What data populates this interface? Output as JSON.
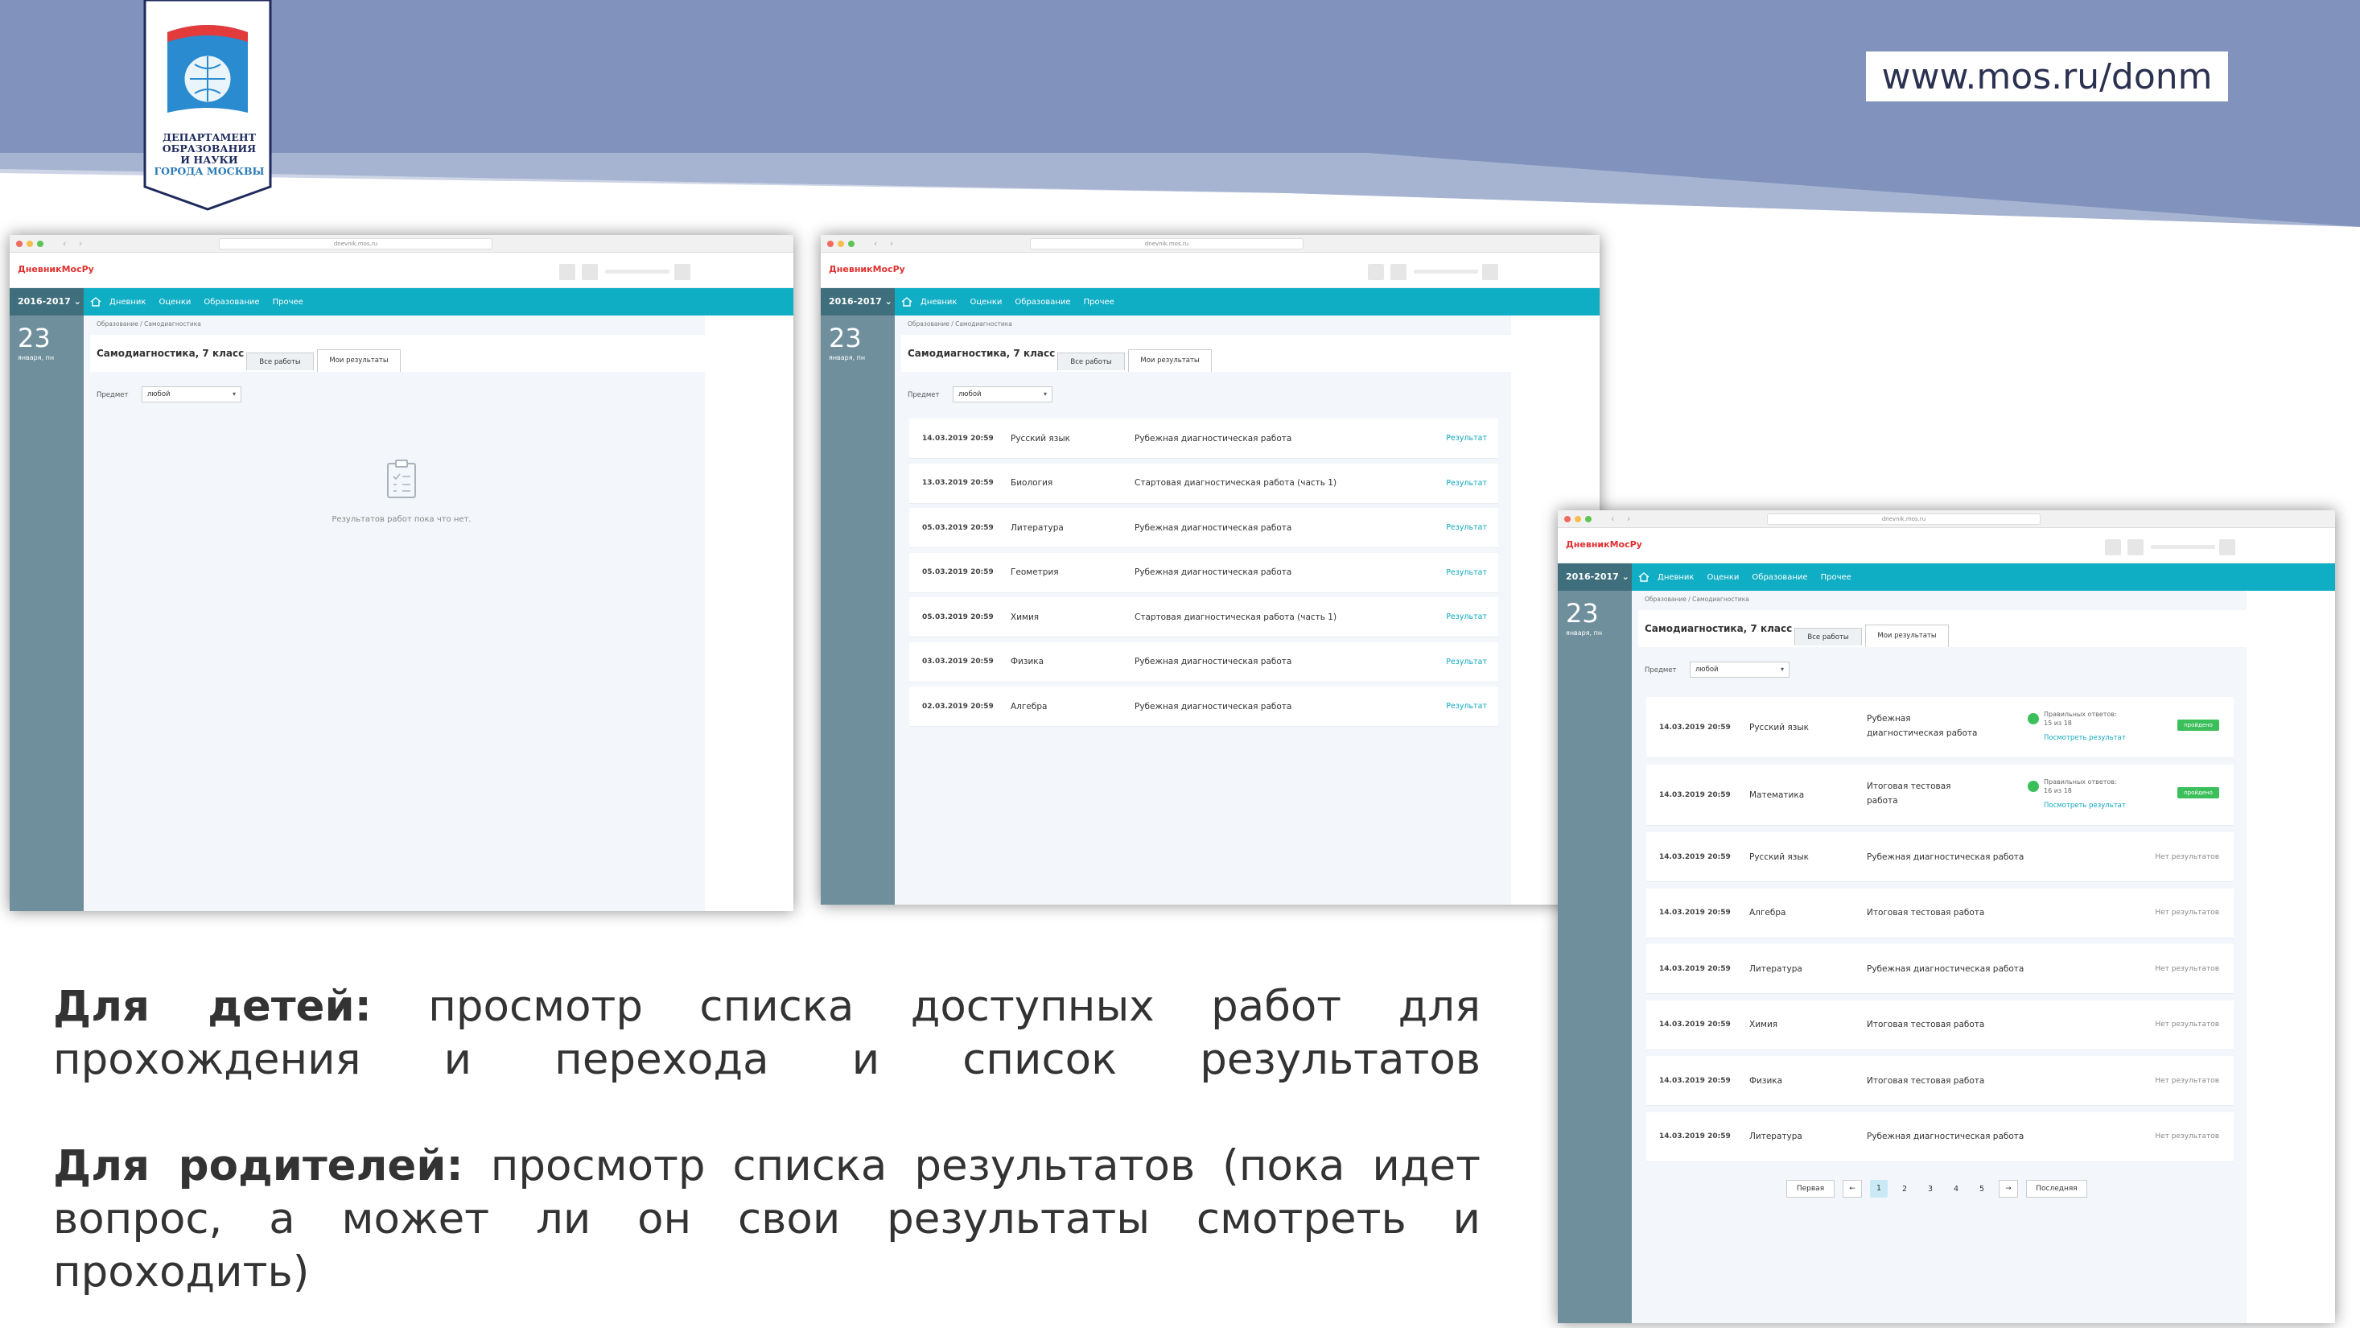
{
  "slide": {
    "website": "www.mos.ru/donm",
    "logo": {
      "line1": "ДЕПАРТАМЕНТ",
      "line2": "ОБРАЗОВАНИЯ",
      "line3": "И НАУКИ",
      "line4": "ГОРОДА МОСКВЫ"
    },
    "caption": {
      "children_label": "Для детей:",
      "children_text": "просмотр списка доступных работ для прохождения и перехода и список результатов",
      "parents_label": "Для родителей:",
      "parents_text": "просмотр списка результатов (пока идет вопрос, а может ли он свои результаты смотреть и проходить)"
    },
    "colors": {
      "band": "#8193bd",
      "teal": "#10aec4",
      "sidebar": "#6f8f9c",
      "green": "#3cbf5a",
      "brand_red": "#e03030"
    }
  },
  "app": {
    "address": "dnevnik.mos.ru",
    "brand": "ДневникМосРу",
    "year": "2016-2017",
    "menu": [
      "Дневник",
      "Оценки",
      "Образование",
      "Прочее"
    ],
    "day_number": "23",
    "day_label": "января, пн",
    "breadcrumb": "Образование  /  Самодиагностика",
    "page_title": "Самодиагностика, 7 класс",
    "tab_all": "Все работы",
    "tab_mine": "Мои результаты",
    "filter_label": "Предмет",
    "filter_value": "любой",
    "empty_message": "Результатов работ пока что нет.",
    "result_link": "Результат",
    "correct_label": "Правильных ответов:",
    "view_result": "Посмотреть результат",
    "passed_badge": "пройдено",
    "no_result": "Нет результатов",
    "pager": {
      "first": "Первая",
      "last": "Последняя",
      "pages": [
        "1",
        "2",
        "3",
        "4",
        "5"
      ],
      "prev_icon": "arrow-left-icon",
      "next_icon": "arrow-right-icon"
    }
  },
  "window2_rows": [
    {
      "date": "14.03.2019 20:59",
      "subject": "Русский язык",
      "work": "Рубежная диагностическая работа"
    },
    {
      "date": "13.03.2019 20:59",
      "subject": "Биология",
      "work": "Стартовая диагностическая работа (часть 1)"
    },
    {
      "date": "05.03.2019 20:59",
      "subject": "Литература",
      "work": "Рубежная диагностическая работа"
    },
    {
      "date": "05.03.2019 20:59",
      "subject": "Геометрия",
      "work": "Рубежная диагностическая работа"
    },
    {
      "date": "05.03.2019 20:59",
      "subject": "Химия",
      "work": "Стартовая диагностическая работа (часть 1)"
    },
    {
      "date": "03.03.2019 20:59",
      "subject": "Физика",
      "work": "Рубежная диагностическая работа"
    },
    {
      "date": "02.03.2019 20:59",
      "subject": "Алгебра",
      "work": "Рубежная диагностическая работа"
    }
  ],
  "window3_rows": [
    {
      "date": "14.03.2019 20:59",
      "subject": "Русский язык",
      "work1": "Рубежная",
      "work2": "диагностическая работа",
      "score": "15 из 18"
    },
    {
      "date": "14.03.2019 20:59",
      "subject": "Математика",
      "work1": "Итоговая тестовая",
      "work2": "работа",
      "score": "16 из 18"
    },
    {
      "date": "14.03.2019 20:59",
      "subject": "Русский язык",
      "work": "Рубежная диагностическая работа"
    },
    {
      "date": "14.03.2019 20:59",
      "subject": "Алгебра",
      "work": "Итоговая тестовая работа"
    },
    {
      "date": "14.03.2019 20:59",
      "subject": "Литература",
      "work": "Рубежная диагностическая работа"
    },
    {
      "date": "14.03.2019 20:59",
      "subject": "Химия",
      "work": "Итоговая тестовая работа"
    },
    {
      "date": "14.03.2019 20:59",
      "subject": "Физика",
      "work": "Итоговая тестовая работа"
    },
    {
      "date": "14.03.2019 20:59",
      "subject": "Литература",
      "work": "Рубежная диагностическая работа"
    }
  ]
}
